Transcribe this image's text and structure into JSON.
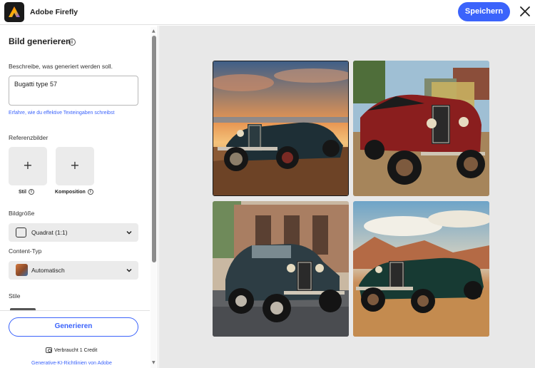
{
  "header": {
    "app_title": "Adobe Firefly",
    "save_label": "Speichern"
  },
  "sidebar": {
    "title": "Bild generieren",
    "prompt_label": "Beschreibe, was generiert werden soll.",
    "prompt_value": "Bugatti type 57",
    "learn_link": "Erfahre, wie du effektive Texteingaben schreibst",
    "reference_label": "Referenzbilder",
    "reference_style": "Stil",
    "reference_composition": "Komposition",
    "size_label": "Bildgröße",
    "size_value": "Quadrat (1:1)",
    "content_type_label": "Content-Typ",
    "content_type_value": "Automatisch",
    "styles_label": "Stile",
    "generate_label": "Generieren",
    "credit_text": "Verbraucht 1 Credit",
    "guidelines_link": "Generative-KI-Richtlinien von Adobe"
  },
  "icons": {
    "logo": "adobe-firefly-logo",
    "close": "close-icon",
    "info": "info-icon",
    "plus": "+",
    "chevron": "chevron-down-icon",
    "square": "square-aspect-icon",
    "credit": "credit-icon"
  },
  "colors": {
    "accent": "#3b63fb",
    "canvas_bg": "#e8e8e8",
    "card_bg": "#ebebeb"
  },
  "results": {
    "images": [
      {
        "alt": "Bugatti type 57 at sunset by the sea",
        "selected": true
      },
      {
        "alt": "Red Bugatti type 57 in village"
      },
      {
        "alt": "Dark blue Bugatti type 57 sedan on street"
      },
      {
        "alt": "Green Bugatti type 57 in desert"
      }
    ]
  }
}
